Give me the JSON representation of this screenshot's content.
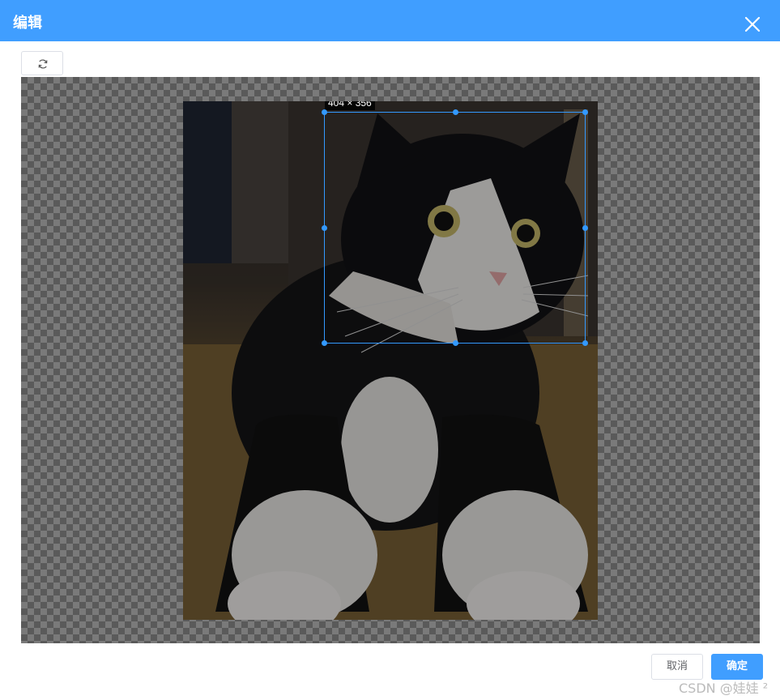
{
  "dialog": {
    "title": "编辑",
    "close_icon": "close-icon"
  },
  "toolbar": {
    "reset_icon": "refresh-icon"
  },
  "cropper": {
    "size_label": "404 × 356",
    "image_description_icon": "cat-photo"
  },
  "footer": {
    "cancel_label": "取消",
    "ok_label": "确定"
  },
  "watermark": "CSDN @娃娃 ²",
  "colors": {
    "header": "#409eff",
    "primary": "#409eff",
    "crop_border": "#3399ff"
  }
}
